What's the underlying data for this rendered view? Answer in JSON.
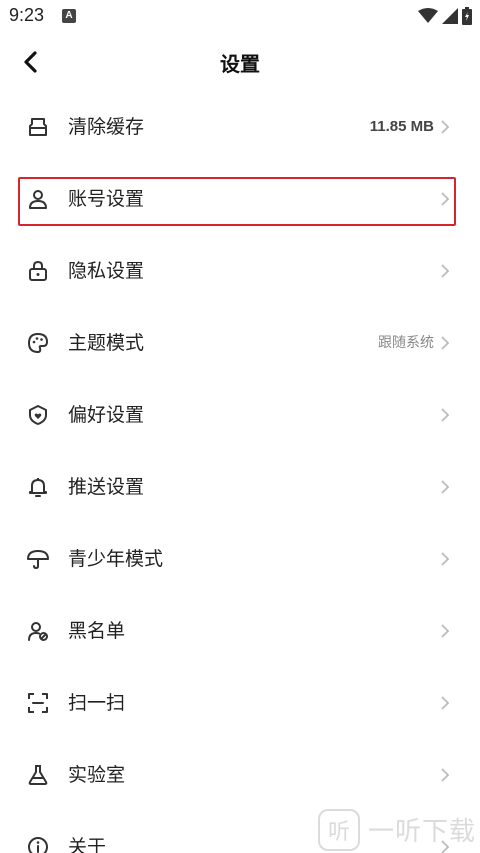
{
  "status_bar": {
    "time": "9:23",
    "notification_glyph": "A"
  },
  "header": {
    "title": "设置"
  },
  "settings": [
    {
      "label": "清除缓存",
      "value": "11.85 MB",
      "icon": "storage-icon"
    },
    {
      "label": "账号设置",
      "value": "",
      "icon": "user-icon"
    },
    {
      "label": "隐私设置",
      "value": "",
      "icon": "lock-icon"
    },
    {
      "label": "主题模式",
      "value": "跟随系统",
      "icon": "palette-icon"
    },
    {
      "label": "偏好设置",
      "value": "",
      "icon": "shield-heart-icon"
    },
    {
      "label": "推送设置",
      "value": "",
      "icon": "bell-icon"
    },
    {
      "label": "青少年模式",
      "value": "",
      "icon": "umbrella-icon"
    },
    {
      "label": "黑名单",
      "value": "",
      "icon": "user-block-icon"
    },
    {
      "label": "扫一扫",
      "value": "",
      "icon": "scan-icon"
    },
    {
      "label": "实验室",
      "value": "",
      "icon": "flask-icon"
    },
    {
      "label": "关于",
      "value": "",
      "icon": "info-icon"
    }
  ],
  "watermark": {
    "logo": "听",
    "text": "一听下载"
  },
  "colors": {
    "highlight": "#d9232d",
    "text": "#222222",
    "secondary": "#888888"
  }
}
